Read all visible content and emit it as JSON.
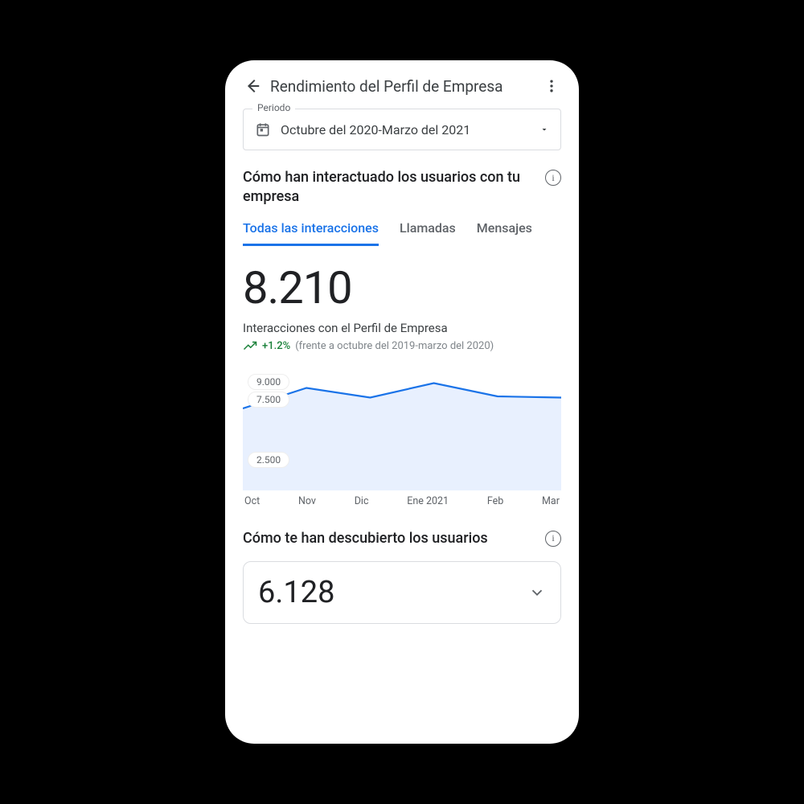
{
  "header": {
    "title": "Rendimiento del Perfil de Empresa"
  },
  "period": {
    "label": "Periodo",
    "value": "Octubre del 2020-Marzo del 2021"
  },
  "interactions": {
    "heading": "Cómo han interactuado los usuarios con tu empresa",
    "tabs": {
      "all": "Todas las interacciones",
      "calls": "Llamadas",
      "messages": "Mensajes"
    },
    "total": "8.210",
    "metric_label": "Interacciones con el Perfil de Empresa",
    "delta": "+1.2%",
    "compare": "(frente a octubre del 2019-marzo del 2020)"
  },
  "discovery": {
    "heading": "Cómo te han descubierto los usuarios",
    "total": "6.128"
  },
  "chart_data": {
    "type": "area",
    "title": "Interacciones con el Perfil de Empresa",
    "xlabel": "",
    "ylabel": "",
    "ylim": [
      0,
      10000
    ],
    "yticks": [
      "9.000",
      "7.500",
      "2.500"
    ],
    "categories": [
      "Oct",
      "Nov",
      "Dic",
      "Ene 2021",
      "Feb",
      "Mar"
    ],
    "values": [
      6800,
      8500,
      7700,
      8900,
      7800,
      7700
    ],
    "series_color": "#1a73e8",
    "fill_color": "#e8f0fe"
  }
}
